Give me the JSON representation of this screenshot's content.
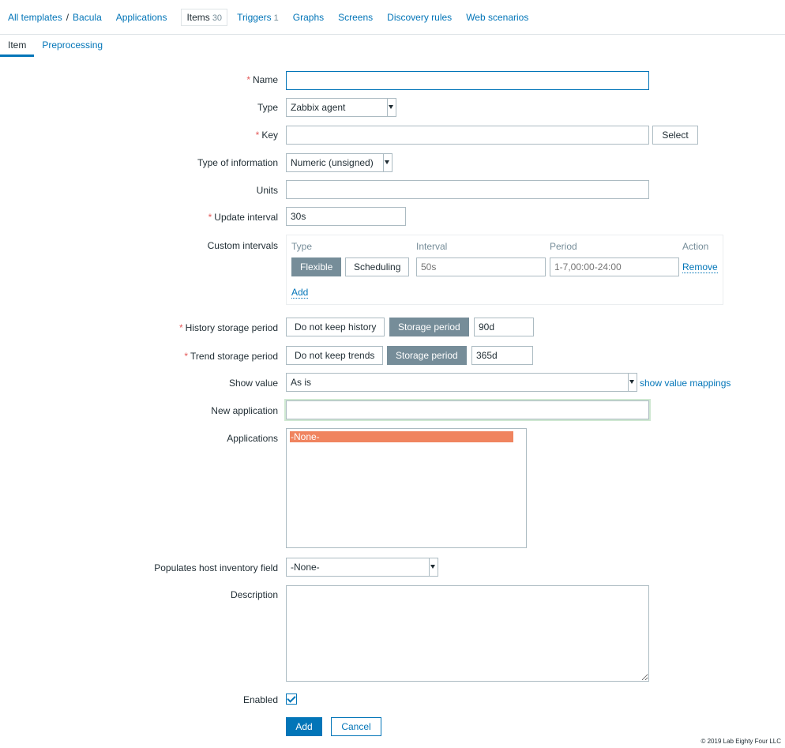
{
  "nav": {
    "all_templates": "All templates",
    "separator": "/",
    "template": "Bacula",
    "applications": "Applications",
    "items": "Items",
    "items_count": "30",
    "triggers": "Triggers",
    "triggers_count": "1",
    "graphs": "Graphs",
    "screens": "Screens",
    "discovery": "Discovery rules",
    "web": "Web scenarios"
  },
  "tabs": {
    "item": "Item",
    "preprocessing": "Preprocessing"
  },
  "form": {
    "required_mark": "*",
    "name_label": "Name",
    "name_value": "",
    "type_label": "Type",
    "type_value": "Zabbix agent",
    "key_label": "Key",
    "key_value": "",
    "select_btn": "Select",
    "info_label": "Type of information",
    "info_value": "Numeric (unsigned)",
    "units_label": "Units",
    "units_value": "",
    "interval_label": "Update interval",
    "interval_value": "30s",
    "custom_label": "Custom intervals",
    "custom": {
      "col_type": "Type",
      "col_interval": "Interval",
      "col_period": "Period",
      "col_action": "Action",
      "flexible": "Flexible",
      "scheduling": "Scheduling",
      "interval_placeholder": "50s",
      "period_placeholder": "1-7,00:00-24:00",
      "remove": "Remove",
      "add": "Add"
    },
    "history_label": "History storage period",
    "history_opt1": "Do not keep history",
    "history_opt2": "Storage period",
    "history_value": "90d",
    "trend_label": "Trend storage period",
    "trend_opt1": "Do not keep trends",
    "trend_opt2": "Storage period",
    "trend_value": "365d",
    "showvalue_label": "Show value",
    "showvalue_value": "As is",
    "showvalue_link": "show value mappings",
    "newapp_label": "New application",
    "newapp_value": "",
    "apps_label": "Applications",
    "apps_selected": "-None-",
    "inventory_label": "Populates host inventory field",
    "inventory_value": "-None-",
    "desc_label": "Description",
    "enabled_label": "Enabled",
    "add_btn": "Add",
    "cancel_btn": "Cancel"
  },
  "footer": "© 2019 Lab Eighty Four LLC",
  "colors": {
    "accent": "#0275b8",
    "selected": "#f0845f",
    "required": "#e45959",
    "toggle_on": "#768d99"
  }
}
